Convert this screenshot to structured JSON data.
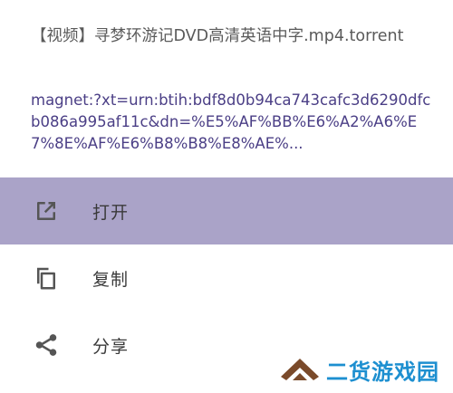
{
  "sheet": {
    "file_title": "【视频】寻梦环游记DVD高清英语中字.mp4.torrent",
    "magnet": "magnet:?xt=urn:btih:bdf8d0b94ca743cafc3d6290dfcb086a995af11c&dn=%E5%AF%BB%E6%A2%A6%E7%8E%AF%E6%B8%B8%E8%AE%..."
  },
  "menu": {
    "items": [
      {
        "label": "打开",
        "icon": "open-external-icon",
        "selected": true
      },
      {
        "label": "复制",
        "icon": "copy-icon",
        "selected": false
      },
      {
        "label": "分享",
        "icon": "share-icon",
        "selected": false
      }
    ]
  },
  "watermark": {
    "text": "二货游戏园",
    "logo": "chevron-logo"
  },
  "colors": {
    "selected_background": "#aaa3c8",
    "link_text": "#4b3f86",
    "title_text": "#5a5a5a",
    "icon": "#555555",
    "watermark_blue": "#1d8fd0",
    "watermark_brown": "#7a4a2a"
  }
}
